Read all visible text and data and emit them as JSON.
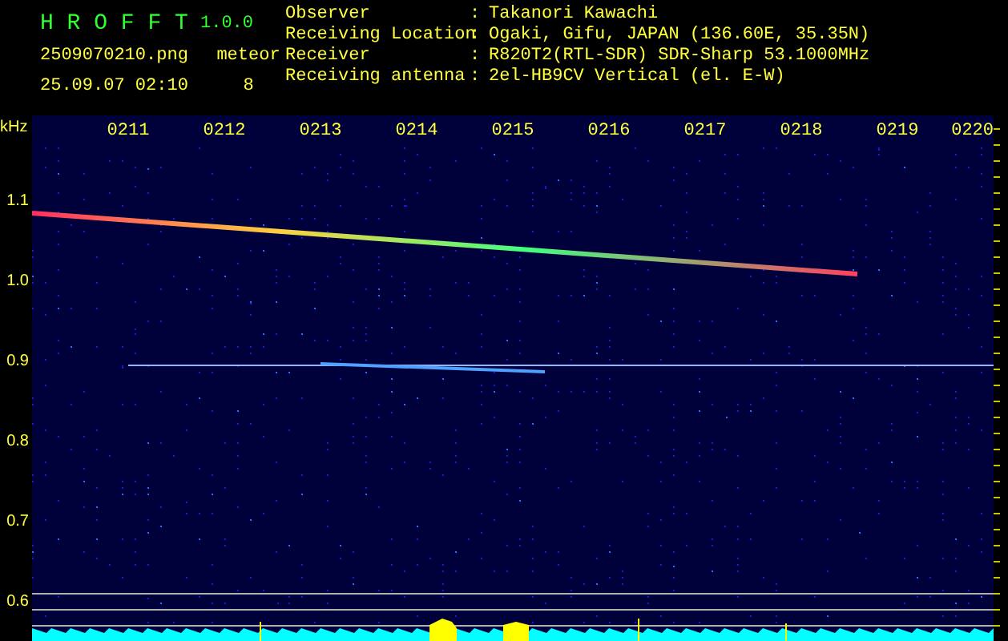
{
  "header": {
    "title": "H R O F F T",
    "version": "1.0.0",
    "filename": "2509070210.png",
    "mode": "meteor",
    "timestamp": "25.09.07 02:10",
    "count": "8"
  },
  "info": [
    {
      "label": "Observer",
      "separator": ":",
      "value": "Takanori Kawachi"
    },
    {
      "label": "Receiving Location",
      "separator": ":",
      "value": "Ogaki, Gifu, JAPAN (136.60E, 35.35N)"
    },
    {
      "label": "Receiver",
      "separator": ":",
      "value": "R820T2(RTL-SDR) SDR-Sharp 53.1000MHz"
    },
    {
      "label": "Receiving antenna",
      "separator": ":",
      "value": "2el-HB9CV Vertical (el. E-W)"
    }
  ],
  "axes": {
    "unit": "kHz",
    "x_labels": [
      "0211",
      "0212",
      "0213",
      "0214",
      "0215",
      "0216",
      "0217",
      "0218",
      "0219",
      "0220"
    ],
    "y_labels": [
      "1.1",
      "1.0",
      "0.9",
      "0.8",
      "0.7",
      "0.6"
    ]
  }
}
